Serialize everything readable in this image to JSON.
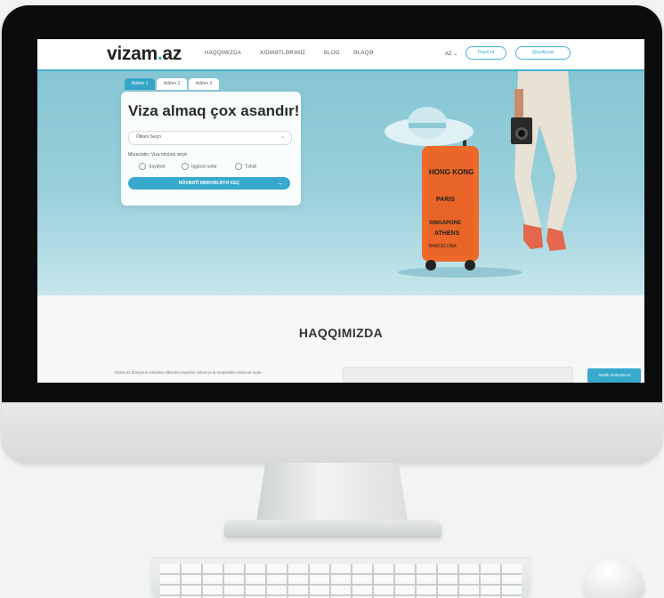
{
  "site": {
    "logo_main": "vizam",
    "logo_dot": ".",
    "logo_tld": "az",
    "nav": {
      "items": [
        "HAQQIMIZDA",
        "XİDMƏTLƏRİMİZ",
        "BLOG",
        "ƏLAQƏ"
      ],
      "lang": "AZ ⌄",
      "login": "Daxil ol",
      "register": "Qeydiyyat"
    },
    "hero": {
      "tabs": [
        "Addım 1",
        "Addım 2",
        "Addım 3"
      ],
      "title": "Viza almaq çox asandır!",
      "country_select": "Ölkəni Seçin",
      "purpose_label": "Müraciətin: Viza növünü seçin",
      "purposes": [
        "Səyahət",
        "İşgüzar səfər",
        "Təhsil"
      ],
      "cta": "NÖVBƏTİ MƏRHƏLƏYƏ KEÇ",
      "cta_arrow": "→",
      "suitcase_words": [
        "HONG KONG",
        "PARIS",
        "SINGAPORE",
        "ATHENS",
        "BARCELONA"
      ]
    },
    "about": {
      "title": "HAQQIMIZDA",
      "text": "Vizam.az dünyanın istənilən ölkəsinə səyahət, təhsil və iş məqsədilə müraciət üçün",
      "button": "Ətraflı məlumat al"
    }
  },
  "colors": {
    "accent": "#36a9cc",
    "hero_bg": "#8fcbd7",
    "suitcase": "#ee6a2a",
    "dark_text": "#2b2b2b"
  }
}
